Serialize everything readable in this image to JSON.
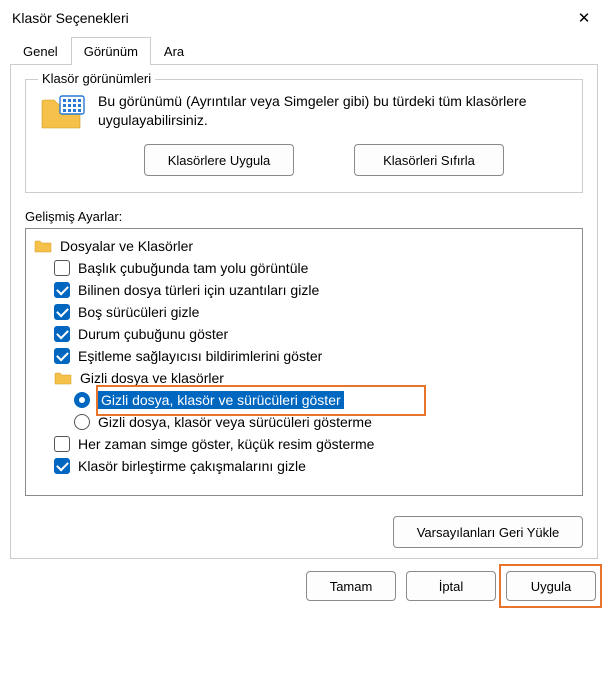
{
  "window": {
    "title": "Klasör Seçenekleri"
  },
  "tabs": {
    "general": "Genel",
    "view": "Görünüm",
    "search": "Ara"
  },
  "folderViews": {
    "legend": "Klasör görünümleri",
    "description": "Bu görünümü (Ayrıntılar veya Simgeler gibi) bu türdeki tüm klasörlere uygulayabilirsiniz.",
    "applyBtn": "Klasörlere Uygula",
    "resetBtn": "Klasörleri Sıfırla"
  },
  "advanced": {
    "label": "Gelişmiş Ayarlar:",
    "root": "Dosyalar ve Klasörler",
    "items": [
      {
        "type": "check",
        "checked": false,
        "label": "Başlık çubuğunda tam yolu görüntüle"
      },
      {
        "type": "check",
        "checked": true,
        "label": "Bilinen dosya türleri için uzantıları gizle"
      },
      {
        "type": "check",
        "checked": true,
        "label": "Boş sürücüleri gizle"
      },
      {
        "type": "check",
        "checked": true,
        "label": "Durum çubuğunu göster"
      },
      {
        "type": "check",
        "checked": true,
        "label": "Eşitleme sağlayıcısı bildirimlerini göster"
      }
    ],
    "hiddenFolder": "Gizli dosya ve klasörler",
    "radios": [
      {
        "checked": true,
        "label": "Gizli dosya, klasör ve sürücüleri göster",
        "selected": true
      },
      {
        "checked": false,
        "label": "Gizli dosya, klasör veya sürücüleri gösterme",
        "selected": false
      }
    ],
    "tail": [
      {
        "type": "check",
        "checked": false,
        "label": "Her zaman simge göster, küçük resim gösterme"
      },
      {
        "type": "check",
        "checked": true,
        "label": "Klasör birleştirme çakışmalarını gizle"
      }
    ]
  },
  "restoreBtn": "Varsayılanları Geri Yükle",
  "footer": {
    "ok": "Tamam",
    "cancel": "İptal",
    "apply": "Uygula"
  }
}
